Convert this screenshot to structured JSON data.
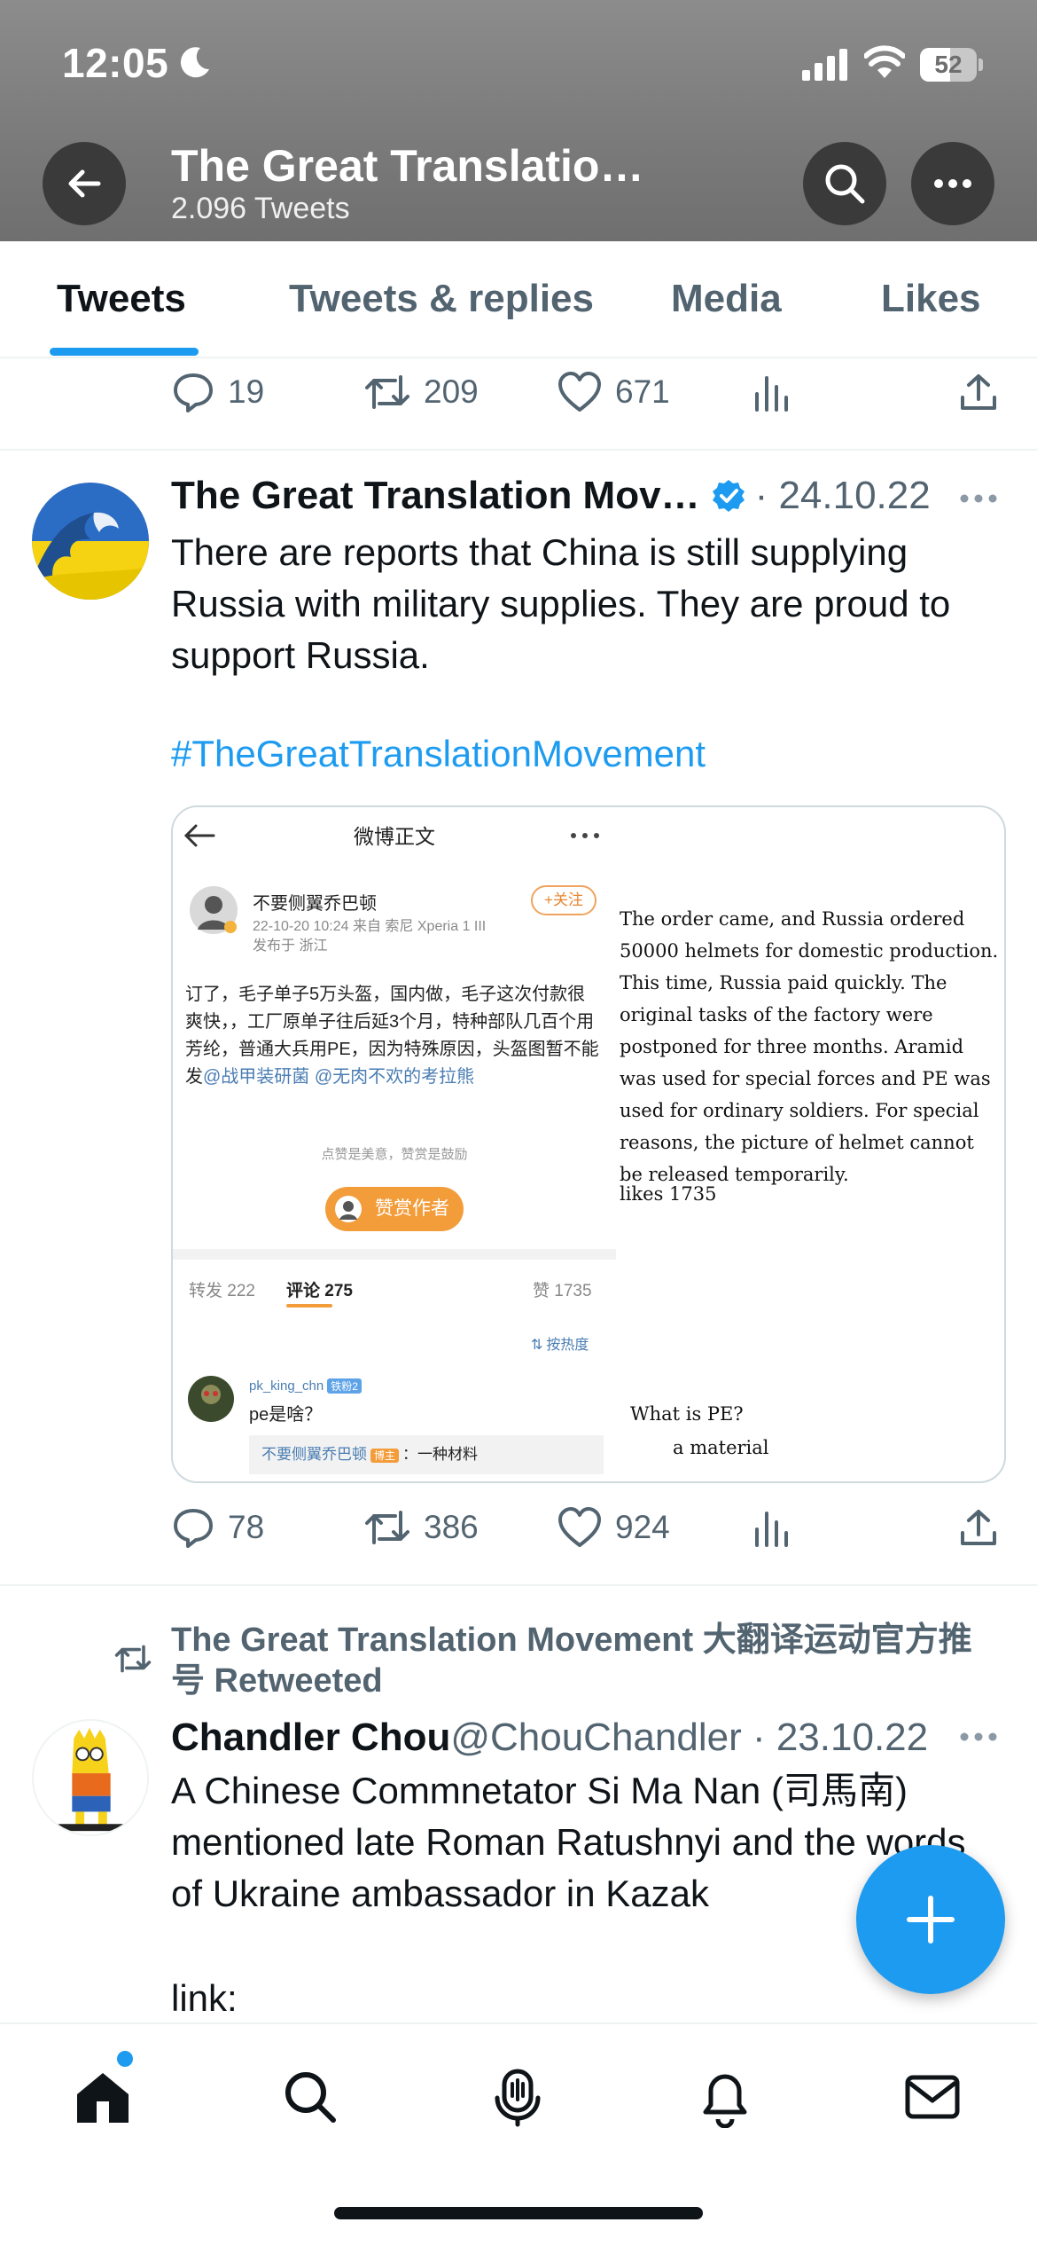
{
  "status_bar": {
    "time": "12:05",
    "battery": "52"
  },
  "header": {
    "title": "The Great Translatio…",
    "subtitle": "2.096 Tweets"
  },
  "tabs": [
    "Tweets",
    "Tweets & replies",
    "Media",
    "Likes"
  ],
  "prev_tweet_actions": {
    "replies": "19",
    "retweets": "209",
    "likes": "671"
  },
  "tweet1": {
    "name": "The Great Translation Mov…",
    "meta": "· 24.10.22",
    "text": "There are reports that China is still supplying Russia with military supplies. They are proud to support Russia.",
    "hashtag": "#TheGreatTranslationMovement",
    "actions": {
      "replies": "78",
      "retweets": "386",
      "likes": "924"
    },
    "media": {
      "title": "微博正文",
      "user": "不要侧翼乔巴顿",
      "date": "22-10-20 10:24  来自 索尼 Xperia 1 III",
      "location": "发布于 浙江",
      "follow": "+关注",
      "body_pre": "订了，毛子单子5万头盔，国内做，毛子这次付款很爽快，，工厂原单子往后延3个月，特种部队几百个用芳纶，普通大兵用PE，因为特殊原因，头盔图暂不能发",
      "body_at": "@战甲装研菌 @无肉不欢的考拉熊",
      "tip": "点赞是美意，赞赏是鼓励",
      "reward": "赞赏作者",
      "reposts": "转发 222",
      "comments": "评论 275",
      "likes_cn": "赞 1735",
      "sort": "按热度",
      "comment_user": "pk_king_chn",
      "comment_badge": "铁粉2",
      "comment_text": "pe是啥？",
      "reply_user": "不要侧翼乔巴顿",
      "reply_badge": "博主",
      "reply_text": "：一种材料",
      "translation": "The order came, and Russia ordered 50000 helmets for domestic production. This time, Russia paid quickly. The original tasks of the factory were postponed for three months. Aramid was used for special forces and PE was used for ordinary soldiers. For special reasons, the picture of helmet cannot be released temporarily.",
      "translation_likes": "likes 1735",
      "translation_q": "What is PE?",
      "translation_a": "a material"
    }
  },
  "retweet_label": "The Great Translation Movement 大翻译运动官方推号 Retweeted",
  "tweet2": {
    "name": "Chandler Chou",
    "meta": " @ChouChandler · 23.10.22",
    "text": "A Chinese Commnetator Si Ma Nan (司馬南) mentioned late Roman Ratushnyi and the words of Ukraine ambassador in Kazak",
    "link_label": "link:"
  },
  "colors": {
    "accent": "#1d9bf0",
    "text": "#0f1419",
    "muted": "#536471"
  }
}
